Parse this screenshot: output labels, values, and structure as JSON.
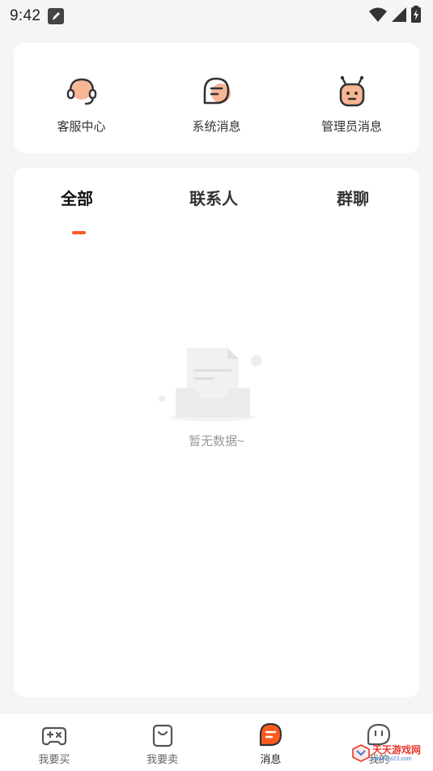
{
  "status_bar": {
    "time": "9:42",
    "left_icons": [
      "note-icon"
    ],
    "right_icons": [
      "wifi-icon",
      "signal-icon",
      "battery-charging-icon"
    ]
  },
  "quick_actions": [
    {
      "label": "客服中心",
      "icon": "headset-icon"
    },
    {
      "label": "系统消息",
      "icon": "chat-bubble-icon"
    },
    {
      "label": "管理员消息",
      "icon": "robot-icon"
    }
  ],
  "tabs": {
    "active": 0,
    "items": [
      {
        "label": "全部"
      },
      {
        "label": "联系人"
      },
      {
        "label": "群聊"
      }
    ]
  },
  "empty_state": {
    "icon": "empty-document-icon",
    "text": "暂无数据~"
  },
  "bottom_nav": {
    "active": 2,
    "items": [
      {
        "label": "我要买",
        "icon": "gamepad-icon"
      },
      {
        "label": "我要卖",
        "icon": "bag-icon"
      },
      {
        "label": "消息",
        "icon": "message-icon"
      },
      {
        "label": "我的",
        "icon": "profile-icon"
      }
    ]
  },
  "watermark": {
    "text": "天天游戏网",
    "sub": "www.ttyi23.com"
  },
  "colors": {
    "accent": "#ff5a1f",
    "peach": "#f7b694",
    "background": "#f5f5f5",
    "card": "#ffffff"
  }
}
